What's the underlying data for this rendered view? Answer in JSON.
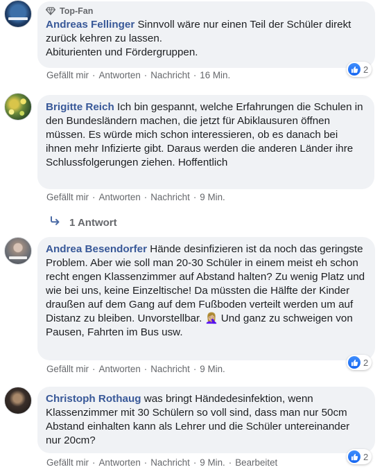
{
  "top_fan_label": "Top-Fan",
  "action_labels": {
    "like": "Gefällt mir",
    "reply": "Antworten",
    "message": "Nachricht",
    "separator": "·"
  },
  "colors": {
    "author": "#385898",
    "bubble": "#f0f2f5",
    "meta": "#65676b",
    "like_blue": "#1877f2"
  },
  "comments": [
    {
      "author": "Andreas Fellinger",
      "text": "Sinnvoll wäre nur einen Teil der Schüler direkt zurück kehren zu lassen.",
      "text2": "Abiturienten und Fördergruppen.",
      "time": "16 Min.",
      "reactions": "2",
      "top_fan": true
    },
    {
      "author": "Brigitte Reich",
      "text": "Ich bin gespannt, welche Erfahrungen die Schulen in den Bundesländern machen, die jetzt für Abiklausuren öffnen müssen. Es würde mich schon interessieren, ob es danach bei ihnen mehr Infizierte gibt. Daraus werden die anderen Länder ihre Schlussfolgerungen ziehen. Hoffentlich",
      "time": "9 Min.",
      "replies": "1 Antwort"
    },
    {
      "author": "Andrea Besendorfer",
      "text": "Hände desinfizieren ist da noch das geringste Problem. Aber wie soll man 20-30 Schüler in einem meist eh schon recht engen Klassenzimmer auf Abstand halten? Zu wenig Platz und wie bei uns, keine Einzeltische! Da müssten die Hälfte der Kinder draußen auf dem Gang auf dem Fußboden verteilt werden um auf Distanz zu bleiben. Unvorstellbar.",
      "emoji": "🤦🏼‍♀️",
      "text2": "Und ganz zu schweigen von Pausen, Fahrten im Bus usw.",
      "time": "9 Min.",
      "reactions": "2"
    },
    {
      "author": "Christoph Rothaug",
      "text": "was bringt Händedesinfektion, wenn Klassenzimmer mit 30 Schülern so voll sind, dass man nur 50cm Abstand einhalten kann als Lehrer und die Schüler untereinander nur 20cm?",
      "time": "9 Min.",
      "edited": "Bearbeitet",
      "reactions": "2"
    }
  ]
}
